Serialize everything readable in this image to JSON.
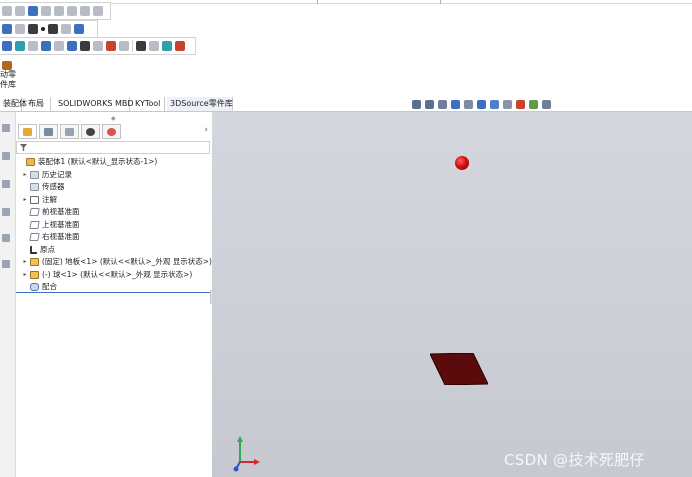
{
  "ribbon": {
    "big_button_line1": "动零",
    "big_button_line2": "件库"
  },
  "tabs": [
    {
      "label": "装配体",
      "active": false
    },
    {
      "label": "布局",
      "active": false
    },
    {
      "label": "SOLIDWORKS MBD",
      "active": false
    },
    {
      "label": "KYTool",
      "active": false
    },
    {
      "label": "3DSource零件库",
      "active": true
    }
  ],
  "feature_tree": {
    "root": "装配体1  (默认<默认_显示状态-1>)",
    "items": [
      {
        "label": "历史记录",
        "expandable": true
      },
      {
        "label": "传感器",
        "expandable": false
      },
      {
        "label": "注解",
        "expandable": true
      },
      {
        "label": "前视基准面",
        "expandable": false
      },
      {
        "label": "上视基准面",
        "expandable": false
      },
      {
        "label": "右视基准面",
        "expandable": false
      },
      {
        "label": "原点",
        "expandable": false
      },
      {
        "label": "(固定) 地板<1> (默认<<默认>_外观 显示状态>)",
        "expandable": true
      },
      {
        "label": "(-) 球<1> (默认<<默认>_外观 显示状态>)",
        "expandable": true
      },
      {
        "label": "配合",
        "expandable": false
      }
    ]
  },
  "watermark": "CSDN @技术死肥仔",
  "colors": {
    "ball": "#d10f0f",
    "plate": "#5a0b0b",
    "viewport_bg": "#cbced4",
    "accent": "#3d6fc0"
  }
}
